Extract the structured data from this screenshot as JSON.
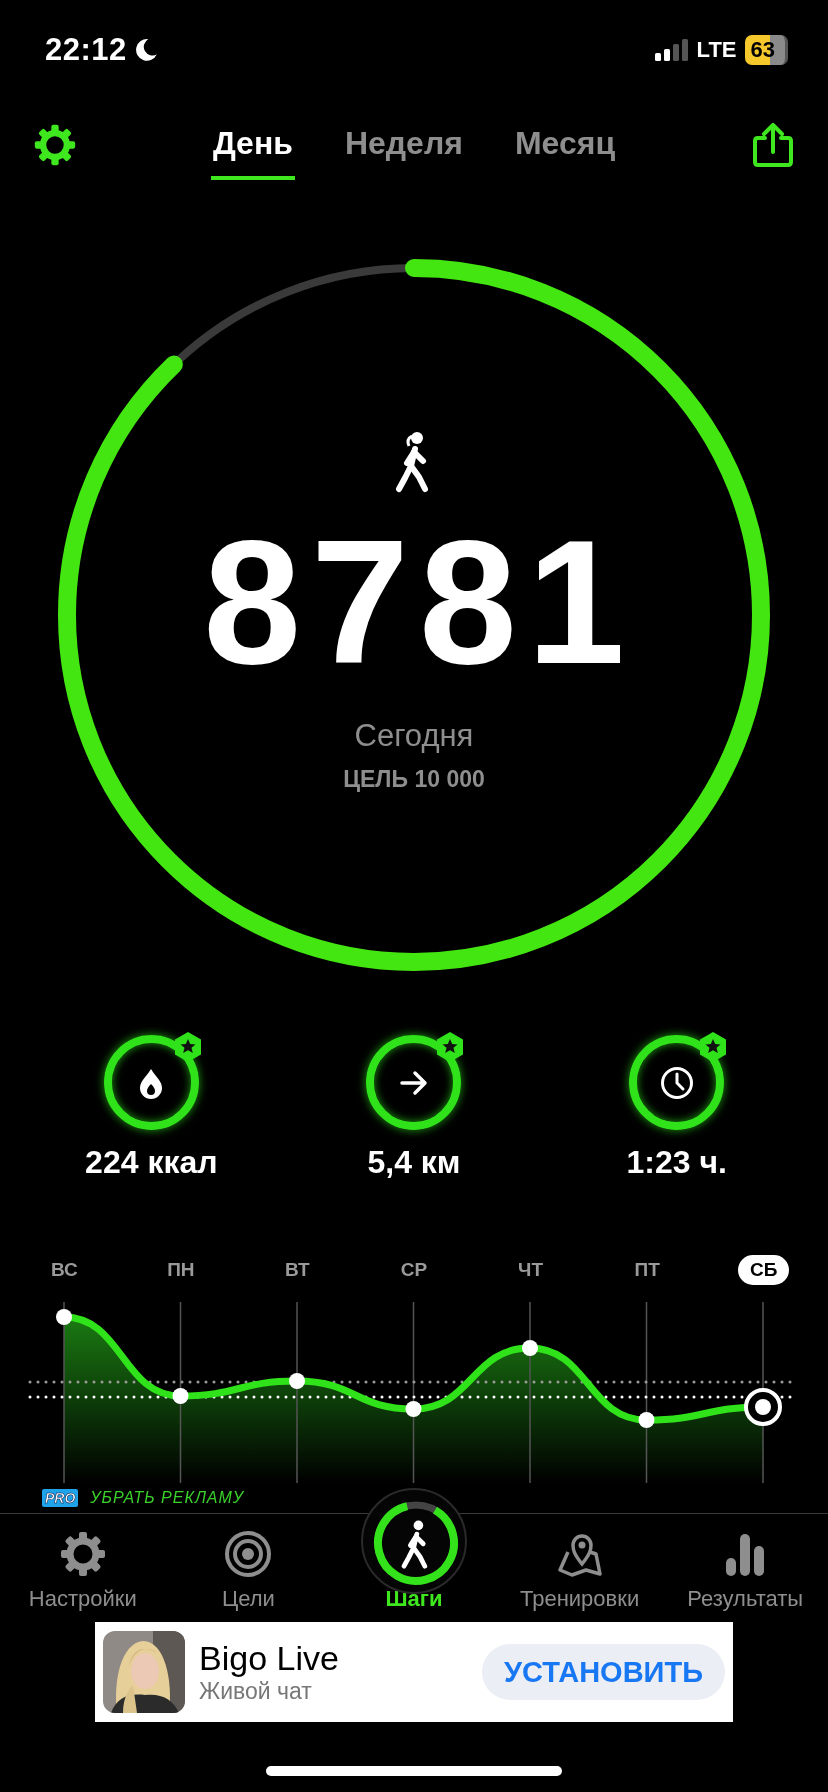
{
  "status_bar": {
    "time": "22:12",
    "network": "LTE",
    "battery": "63"
  },
  "header": {
    "tabs": [
      {
        "label": "День",
        "selected": true
      },
      {
        "label": "Неделя",
        "selected": false
      },
      {
        "label": "Месяц",
        "selected": false
      }
    ]
  },
  "steps": {
    "count": "8781",
    "caption": "Сегодня",
    "goal": "ЦЕЛЬ 10 000",
    "level": 0.878
  },
  "stats": [
    {
      "kind": "calories",
      "value": "224 ккал"
    },
    {
      "kind": "distance",
      "value": "5,4 км"
    },
    {
      "kind": "time",
      "value": "1:23 ч."
    }
  ],
  "week": {
    "days": [
      {
        "label": "ВС",
        "selected": false
      },
      {
        "label": "ПН",
        "selected": false
      },
      {
        "label": "ВТ",
        "selected": false
      },
      {
        "label": "СР",
        "selected": false
      },
      {
        "label": "ЧТ",
        "selected": false
      },
      {
        "label": "ПТ",
        "selected": false
      },
      {
        "label": "СБ",
        "selected": true
      }
    ]
  },
  "promo": {
    "badge": "PRO",
    "text": "УБРАТЬ РЕКЛАМУ"
  },
  "tab_bar": [
    {
      "kind": "settings",
      "label": "Настройки",
      "selected": false
    },
    {
      "kind": "goals",
      "label": "Цели",
      "selected": false
    },
    {
      "kind": "steps",
      "label": "Шаги",
      "selected": true
    },
    {
      "kind": "workouts",
      "label": "Тренировки",
      "selected": false
    },
    {
      "kind": "results",
      "label": "Результаты",
      "selected": false
    }
  ],
  "ad": {
    "kind": "picture",
    "title": "Bigo Live",
    "subtitle": "Живой чат",
    "button": "УСТАНОВИТЬ"
  }
}
